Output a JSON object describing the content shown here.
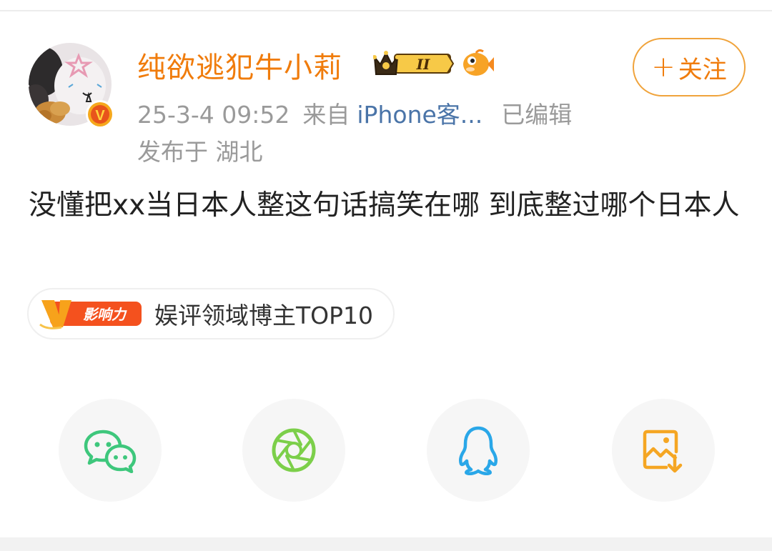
{
  "post": {
    "username": "纯欲逃犯牛小莉",
    "level_badge": "II",
    "vip_badge_letter": "V",
    "follow_label": "关注",
    "follow_plus": "+",
    "timestamp": "25-3-4 09:52",
    "source_prefix": "来自",
    "source": "iPhone客...",
    "edited": "已编辑",
    "location": "发布于 湖北",
    "text": "没懂把xx当日本人整这句话搞笑在哪 到底整过哪个日本人",
    "influence_badge": "影响力",
    "influence_badge_letter": "V",
    "influence_label": "娱评领域博主TOP10"
  },
  "share": {
    "items": [
      {
        "icon": "wechat-icon",
        "color": "#3ec77c"
      },
      {
        "icon": "moments-icon",
        "color": "#7ccf4a"
      },
      {
        "icon": "qq-icon",
        "color": "#2aa7e8"
      },
      {
        "icon": "save-image-icon",
        "color": "#f5a623"
      }
    ]
  },
  "colors": {
    "accent": "#f07c0c",
    "link": "#4a74a8",
    "meta": "#9a9a9a",
    "text": "#222222"
  }
}
